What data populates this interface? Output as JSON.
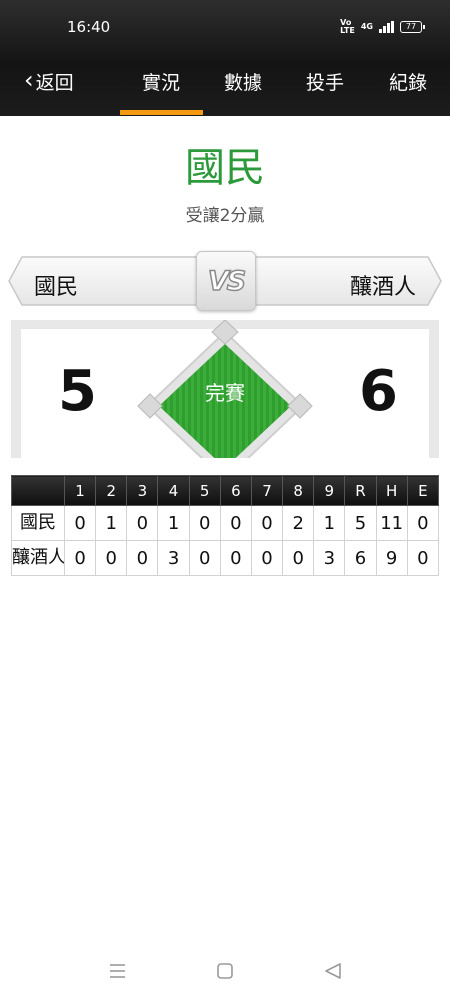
{
  "status_bar": {
    "time": "16:40",
    "network": "Vo LTE",
    "signal": "4G",
    "battery": "77"
  },
  "nav": {
    "back_label": "返回",
    "tabs": [
      "實況",
      "數據",
      "投手",
      "紀錄"
    ],
    "active_tab": 0
  },
  "result": {
    "winner": "國民",
    "subtitle": "受讓2分贏"
  },
  "matchup": {
    "home": "國民",
    "away": "釀酒人",
    "vs": "VS"
  },
  "scoreboard": {
    "home_score": "5",
    "away_score": "6",
    "status": "完賽"
  },
  "linescore": {
    "headers": [
      "",
      "1",
      "2",
      "3",
      "4",
      "5",
      "6",
      "7",
      "8",
      "9",
      "R",
      "H",
      "E"
    ],
    "rows": [
      {
        "team": "國民",
        "cells": [
          "0",
          "1",
          "0",
          "1",
          "0",
          "0",
          "0",
          "2",
          "1",
          "5",
          "11",
          "0"
        ]
      },
      {
        "team": "釀酒人",
        "cells": [
          "0",
          "0",
          "0",
          "3",
          "0",
          "0",
          "0",
          "0",
          "3",
          "6",
          "9",
          "0"
        ]
      }
    ]
  },
  "colors": {
    "accent": "#f39a12",
    "winner_green": "#2c9a3a",
    "field_green": "#2f9e2f",
    "topbar": "#1a1a1a"
  },
  "system_nav": [
    "menu-icon",
    "home-icon",
    "back-icon"
  ]
}
